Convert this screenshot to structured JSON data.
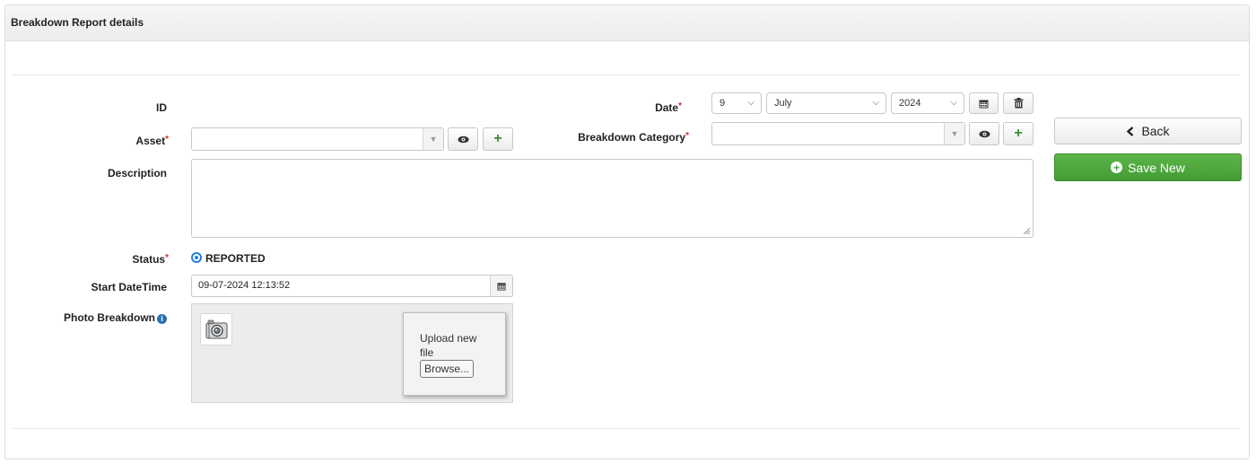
{
  "panel": {
    "title": "Breakdown Report details"
  },
  "labels": {
    "id": "ID",
    "asset": "Asset",
    "description": "Description",
    "status": "Status",
    "start_datetime": "Start DateTime",
    "photo": "Photo Breakdown",
    "date": "Date",
    "category": "Breakdown Category",
    "required_mark": "*"
  },
  "fields": {
    "asset_value": "",
    "category_value": "",
    "description_value": "",
    "date_day": "9",
    "date_month": "July",
    "date_year": "2024",
    "start_datetime_value": "09-07-2024 12:13:52"
  },
  "status": {
    "selected": "REPORTED"
  },
  "photo": {
    "upload_text_line1": "Upload new",
    "upload_text_line2": "file",
    "browse_label": "Browse..."
  },
  "actions": {
    "back_label": "Back",
    "save_label": "Save New"
  },
  "icons": {
    "eye": "eye-icon",
    "plus": "plus-icon",
    "calendar": "calendar-icon",
    "trash": "trash-icon",
    "chevron_left": "chevron-left-icon",
    "plus_circle": "plus-circle-icon",
    "camera": "camera-icon",
    "info": "info-icon"
  },
  "colors": {
    "save_green": "#449c34",
    "required_red": "#c9302c",
    "radio_blue": "#1e7fe0",
    "plus_green": "#3a8d32"
  }
}
